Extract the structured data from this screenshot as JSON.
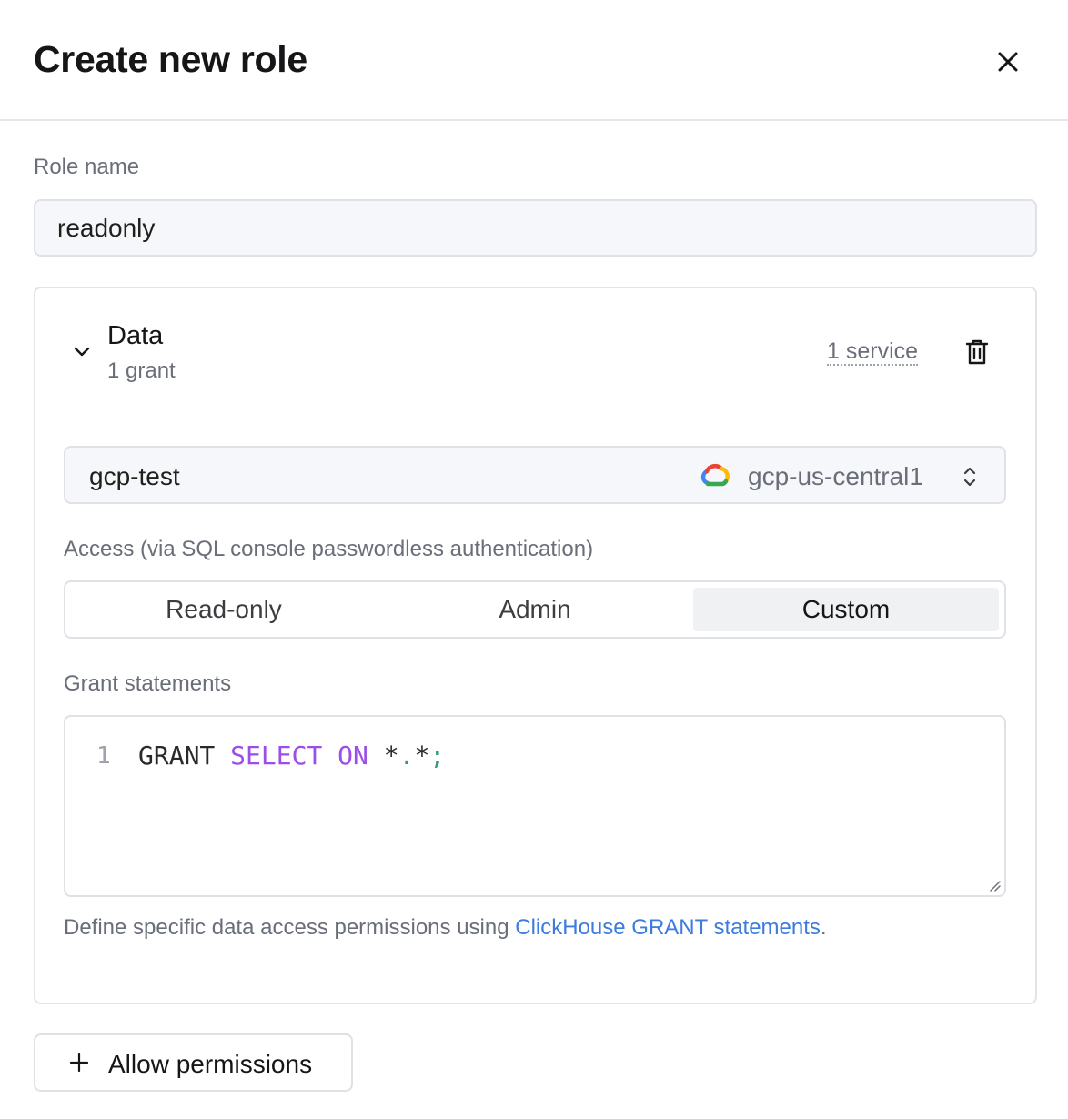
{
  "header": {
    "title": "Create new role",
    "close_icon": "close-icon"
  },
  "role": {
    "label": "Role name",
    "value": "readonly"
  },
  "permission_section": {
    "title": "Data",
    "subtitle": "1 grant",
    "service_count": "1 service",
    "collapse_icon": "chevron-down-icon",
    "delete_icon": "trash-icon",
    "service_select": {
      "name": "gcp-test",
      "provider_icon": "google-cloud-icon",
      "region": "gcp-us-central1"
    },
    "access": {
      "label": "Access (via SQL console passwordless authentication)",
      "options": [
        "Read-only",
        "Admin",
        "Custom"
      ],
      "selected": "Custom"
    },
    "grant": {
      "label": "Grant statements",
      "line_number": "1",
      "tokens": {
        "t1": "GRANT",
        "t2": "SELECT",
        "t3": "ON",
        "t4": "*",
        "t5": ".",
        "t6": "*",
        "t7": ";"
      }
    },
    "helper": {
      "prefix": "Define specific data access permissions using ",
      "link": "ClickHouse GRANT statements",
      "suffix": "."
    }
  },
  "allow_button": {
    "label": "Allow permissions",
    "icon": "plus-icon"
  },
  "colors": {
    "keyword": "#9b4ee8",
    "link": "#3d7bdd",
    "selected_segment": "#f0f1f3"
  }
}
